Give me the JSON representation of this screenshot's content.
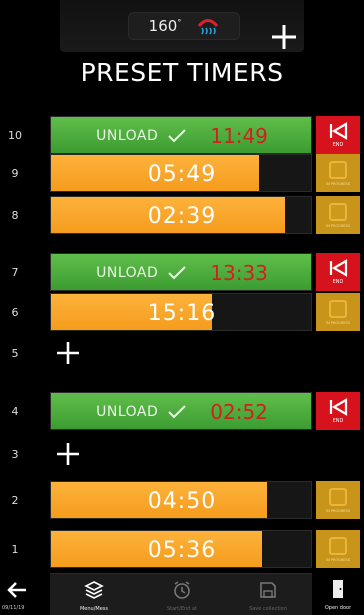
{
  "header": {
    "temperature": "160",
    "temperature_unit": "°",
    "title": "PRESET TIMERS"
  },
  "slots": [
    {
      "number": "10",
      "kind": "unload",
      "label": "UNLOAD",
      "time": "11:49",
      "action": "END"
    },
    {
      "number": "9",
      "kind": "timer",
      "time": "05:49",
      "progress": 0.8,
      "action": "IN PROGRESS"
    },
    {
      "number": "8",
      "kind": "timer",
      "time": "02:39",
      "progress": 0.9,
      "action": "IN PROGRESS"
    },
    {
      "number": "7",
      "kind": "unload",
      "label": "UNLOAD",
      "time": "13:33",
      "action": "END"
    },
    {
      "number": "6",
      "kind": "timer",
      "time": "15:16",
      "progress": 0.62,
      "action": "IN PROGRESS"
    },
    {
      "number": "5",
      "kind": "empty"
    },
    {
      "number": "4",
      "kind": "unload",
      "label": "UNLOAD",
      "time": "02:52",
      "action": "END"
    },
    {
      "number": "3",
      "kind": "empty"
    },
    {
      "number": "2",
      "kind": "timer",
      "time": "04:50",
      "progress": 0.83,
      "action": "IN PROGRESS"
    },
    {
      "number": "1",
      "kind": "timer",
      "time": "05:36",
      "progress": 0.81,
      "action": "IN PROGRESS"
    }
  ],
  "bottom_bar": {
    "date": "09/11/19",
    "menu_label": "Menu/Mess",
    "start_label": "Start/End at",
    "save_label": "Save collection",
    "door_label": "Open door"
  },
  "colors": {
    "timer_fill": "#f7a526",
    "unload_fill": "#4caf3e",
    "end_button": "#d6121d",
    "progress_button": "#c8951a",
    "unload_time": "#d1211c"
  }
}
